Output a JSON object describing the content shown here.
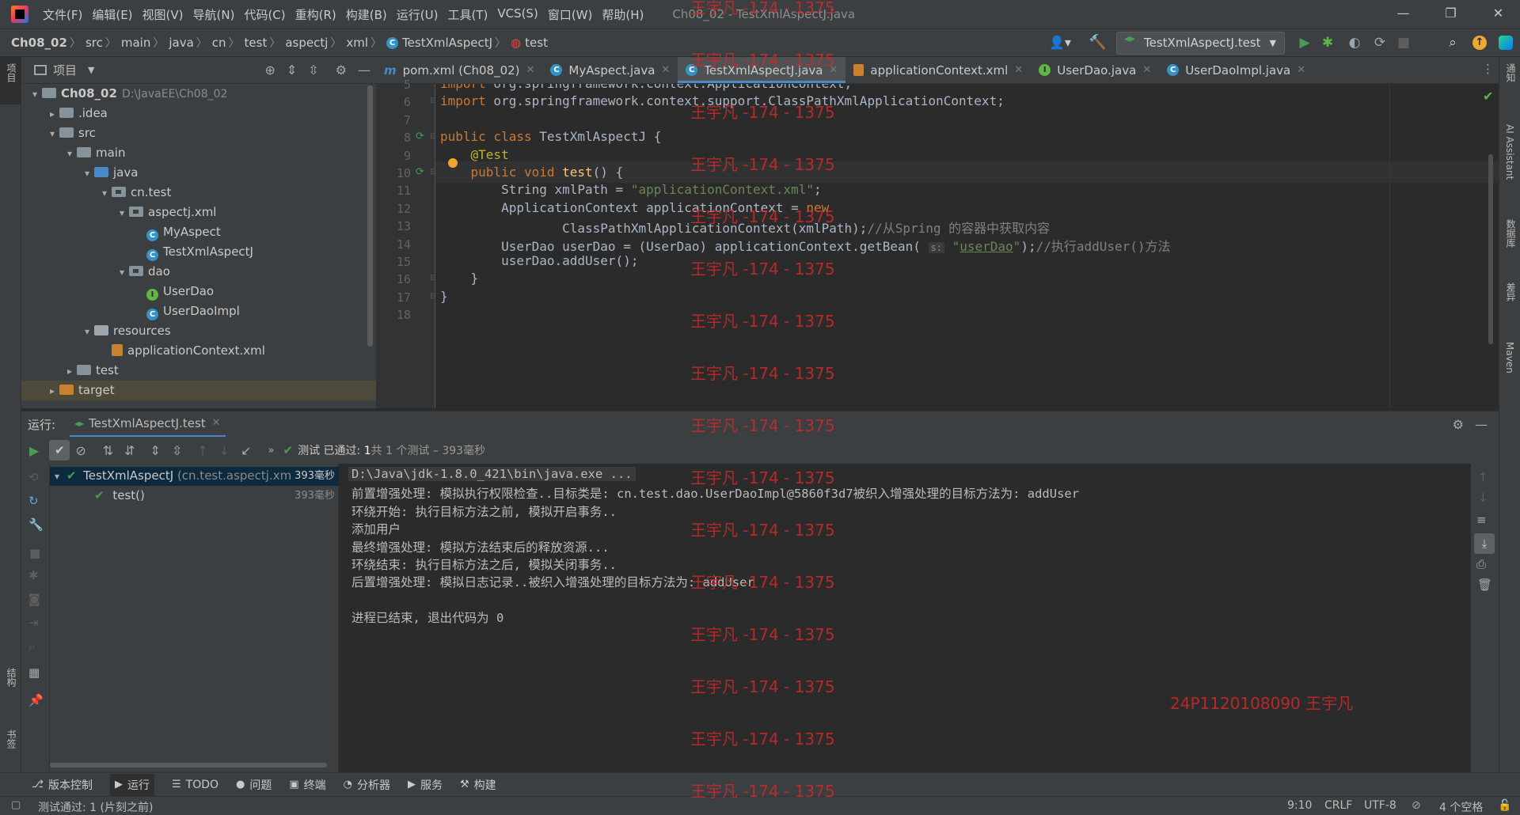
{
  "menubar": {
    "items": [
      "文件(F)",
      "编辑(E)",
      "视图(V)",
      "导航(N)",
      "代码(C)",
      "重构(R)",
      "构建(B)",
      "运行(U)",
      "工具(T)",
      "VCS(S)",
      "窗口(W)",
      "帮助(H)"
    ],
    "title": "Ch08_02 - TestXmlAspectJ.java"
  },
  "navbar": {
    "crumbs": [
      "Ch08_02",
      "src",
      "main",
      "java",
      "cn",
      "test",
      "aspectj",
      "xml",
      "TestXmlAspectJ",
      "test"
    ],
    "run_config": "TestXmlAspectJ.test"
  },
  "project": {
    "header": "项目",
    "tree": [
      {
        "label": "Ch08_02",
        "path": "D:\\JavaEE\\Ch08_02",
        "depth": 0,
        "arrow": "▾",
        "kind": "folder"
      },
      {
        "label": ".idea",
        "depth": 1,
        "arrow": "▸",
        "kind": "folder"
      },
      {
        "label": "src",
        "depth": 1,
        "arrow": "▾",
        "kind": "folder"
      },
      {
        "label": "main",
        "depth": 2,
        "arrow": "▾",
        "kind": "folder"
      },
      {
        "label": "java",
        "depth": 3,
        "arrow": "▾",
        "kind": "folder-blue"
      },
      {
        "label": "cn.test",
        "depth": 4,
        "arrow": "▾",
        "kind": "package"
      },
      {
        "label": "aspectj.xml",
        "depth": 5,
        "arrow": "▾",
        "kind": "package"
      },
      {
        "label": "MyAspect",
        "depth": 6,
        "arrow": "",
        "kind": "class"
      },
      {
        "label": "TestXmlAspectJ",
        "depth": 6,
        "arrow": "",
        "kind": "class"
      },
      {
        "label": "dao",
        "depth": 5,
        "arrow": "▾",
        "kind": "package"
      },
      {
        "label": "UserDao",
        "depth": 6,
        "arrow": "",
        "kind": "interface"
      },
      {
        "label": "UserDaoImpl",
        "depth": 6,
        "arrow": "",
        "kind": "class"
      },
      {
        "label": "resources",
        "depth": 3,
        "arrow": "▾",
        "kind": "folder-res"
      },
      {
        "label": "applicationContext.xml",
        "depth": 4,
        "arrow": "",
        "kind": "xml"
      },
      {
        "label": "test",
        "depth": 2,
        "arrow": "▸",
        "kind": "folder"
      },
      {
        "label": "target",
        "depth": 1,
        "arrow": "▸",
        "kind": "folder-orange"
      }
    ]
  },
  "tabs": [
    {
      "label": "pom.xml (Ch08_02)",
      "icon": "m",
      "active": false
    },
    {
      "label": "MyAspect.java",
      "icon": "C",
      "active": false
    },
    {
      "label": "TestXmlAspectJ.java",
      "icon": "C",
      "active": true
    },
    {
      "label": "applicationContext.xml",
      "icon": "xml",
      "active": false
    },
    {
      "label": "UserDao.java",
      "icon": "I",
      "active": false
    },
    {
      "label": "UserDaoImpl.java",
      "icon": "C",
      "active": false
    }
  ],
  "editor": {
    "lines": [
      {
        "n": "5",
        "html": "<span class='kw'>import</span> org.springframework.context.ApplicationContext;"
      },
      {
        "n": "6",
        "html": "<span class='kw'>import</span> org.springframework.context.support.ClassPathXmlApplicationContext;"
      },
      {
        "n": "7",
        "html": ""
      },
      {
        "n": "8",
        "html": "<span class='kw'>public class</span> TestXmlAspectJ {"
      },
      {
        "n": "9",
        "html": "    <span class='ann'>@Test</span>"
      },
      {
        "n": "10",
        "html": "    <span class='kw'>public void</span> <span class='fn'>test</span>() {"
      },
      {
        "n": "11",
        "html": "        String xmlPath = <span class='str'>\"applicationContext.xml\"</span>;"
      },
      {
        "n": "12",
        "html": "        ApplicationContext applicationContext = <span class='kw'>new</span>"
      },
      {
        "n": "13",
        "html": "                ClassPathXmlApplicationContext(xmlPath);<span class='cmt'>//从Spring 的容器中获取内容</span>"
      },
      {
        "n": "14",
        "html": "        UserDao userDao = (UserDao) applicationContext.getBean( <span class='hint'>s:</span> <span class='str'>\"<u>userDao</u>\"</span>);<span class='cmt'>//执行addUser()方法</span>"
      },
      {
        "n": "15",
        "html": "        userDao.addUser();"
      },
      {
        "n": "16",
        "html": "    }"
      },
      {
        "n": "17",
        "html": "}"
      },
      {
        "n": "18",
        "html": ""
      }
    ]
  },
  "run": {
    "label": "运行:",
    "tab": "TestXmlAspectJ.test",
    "status_prefix": "测试 已通过:",
    "status_count": "1",
    "status_rest": "共 1 个测试 – 393毫秒",
    "tree": [
      {
        "label": "TestXmlAspectJ",
        "sub": "(cn.test.aspectj.xm",
        "time": "393毫秒"
      },
      {
        "label": "test()",
        "time": "393毫秒"
      }
    ],
    "console": [
      "D:\\Java\\jdk-1.8.0_421\\bin\\java.exe ...",
      "前置增强处理: 模拟执行权限检查..目标类是: cn.test.dao.UserDaoImpl@5860f3d7被织入增强处理的目标方法为: addUser",
      "环绕开始: 执行目标方法之前, 模拟开启事务..",
      "添加用户",
      "最终增强处理: 模拟方法结束后的释放资源...",
      "环绕结束: 执行目标方法之后, 模拟关闭事务..",
      "后置增强处理: 模拟日志记录..被织入增强处理的目标方法为: addUser",
      "",
      "进程已结束, 退出代码为 0"
    ]
  },
  "bottom_tabs": [
    "版本控制",
    "运行",
    "TODO",
    "问题",
    "终端",
    "分析器",
    "服务",
    "构建"
  ],
  "status": {
    "left": "测试通过: 1 (片刻之前)",
    "position": "9:10",
    "line_sep": "CRLF",
    "encoding": "UTF-8",
    "indent": "4 个空格"
  },
  "left_strip": {
    "project": "项目",
    "structure": "结构",
    "bookmarks": "书签"
  },
  "right_strip": {
    "notifications": "通知",
    "ai": "AI Assistant",
    "db": "数据库",
    "diff": "差异",
    "maven": "Maven"
  },
  "watermark": {
    "text": "王宇凡 -174 - 1375",
    "signature": "24P1120108090 王宇凡"
  },
  "colors": {
    "accent": "#4a88c7",
    "pass": "#499c54",
    "run": "#499c54",
    "watermark": "#cc2a2a"
  }
}
